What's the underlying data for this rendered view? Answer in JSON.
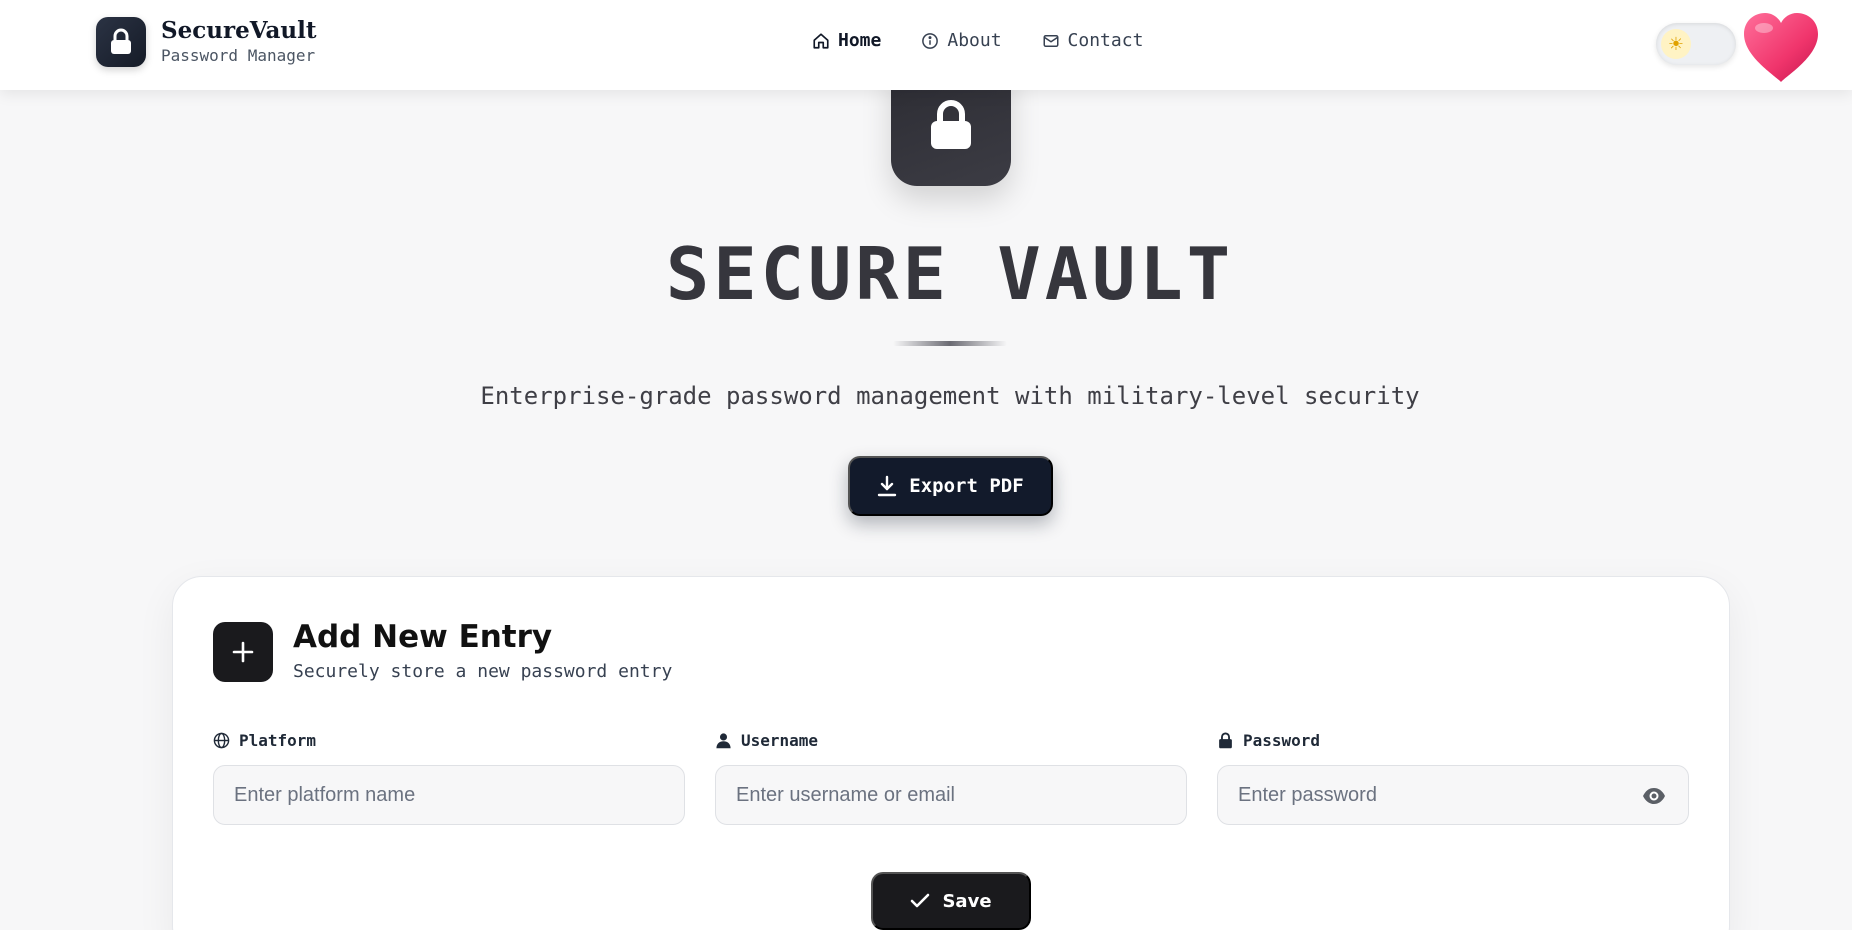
{
  "brand": {
    "title": "SecureVault",
    "subtitle": "Password Manager",
    "logo_icon": "lock-icon"
  },
  "nav": {
    "items": [
      {
        "label": "Home",
        "icon": "home-icon",
        "active": true
      },
      {
        "label": "About",
        "icon": "info-icon",
        "active": false
      },
      {
        "label": "Contact",
        "icon": "mail-icon",
        "active": false
      }
    ],
    "theme_toggle": {
      "icon": "sun-icon",
      "glyph": "☀",
      "mode": "light"
    },
    "heart_icon": "heart-icon"
  },
  "hero": {
    "icon": "lock-icon",
    "title": "SECURE VAULT",
    "subtitle": "Enterprise-grade password management with military-level security",
    "export_label": "Export PDF",
    "export_icon": "download-icon"
  },
  "form": {
    "icon": "plus-icon",
    "title": "Add New Entry",
    "subtitle": "Securely store a new password entry",
    "fields": [
      {
        "label": "Platform",
        "icon": "globe-icon",
        "placeholder": "Enter platform name",
        "value": ""
      },
      {
        "label": "Username",
        "icon": "user-icon",
        "placeholder": "Enter username or email",
        "value": ""
      },
      {
        "label": "Password",
        "icon": "lock-icon",
        "placeholder": "Enter password",
        "value": "",
        "toggle_icon": "eye-icon"
      }
    ],
    "save_label": "Save",
    "save_icon": "check-icon"
  },
  "colors": {
    "primary_dark": "#121a2b",
    "card_icon_bg": "#1a1a1d",
    "hero_lock_bg": "#2c2c33",
    "heart": "#f0437a",
    "page_bg": "#f7f7f8"
  }
}
